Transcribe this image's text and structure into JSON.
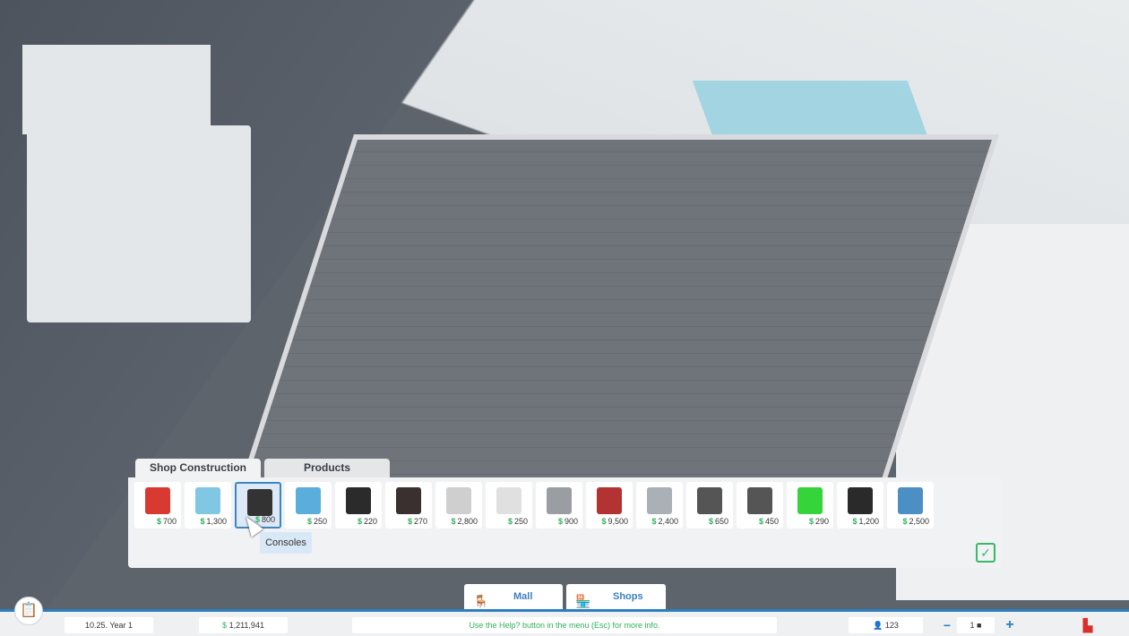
{
  "tabs": [
    {
      "label": "Shop Construction",
      "active": true
    },
    {
      "label": "Products",
      "active": false
    }
  ],
  "items": [
    {
      "icon": "gaming-chair",
      "price": "700",
      "color": "#d83a32"
    },
    {
      "icon": "glass-display-counter",
      "price": "1,300",
      "color": "#7fc7e3"
    },
    {
      "icon": "console-stand",
      "price": "800",
      "color": "#333333",
      "selected": true
    },
    {
      "icon": "glass-wall-shelf",
      "price": "250",
      "color": "#5aaedb"
    },
    {
      "icon": "display-pedestal",
      "price": "220",
      "color": "#2b2b2b"
    },
    {
      "icon": "product-shelf",
      "price": "270",
      "color": "#3a3030"
    },
    {
      "icon": "monitor-table",
      "price": "2,800",
      "color": "#cfcfcf"
    },
    {
      "icon": "vr-stand",
      "price": "250",
      "color": "#e0e0e0"
    },
    {
      "icon": "pc-desk-row",
      "price": "900",
      "color": "#9a9ea3"
    },
    {
      "icon": "showcase-pedestal",
      "price": "9,500",
      "color": "#b33232"
    },
    {
      "icon": "long-display-table",
      "price": "2,400",
      "color": "#aab0b6"
    },
    {
      "icon": "racing-simulator",
      "price": "650",
      "color": "#555555"
    },
    {
      "icon": "cube-display",
      "price": "450",
      "color": "#555555"
    },
    {
      "icon": "green-screen",
      "price": "290",
      "color": "#35d43a"
    },
    {
      "icon": "gaming-desk",
      "price": "1,200",
      "color": "#2a2a2a"
    },
    {
      "icon": "cashier-counter",
      "price": "2,500",
      "color": "#4c8fc4"
    }
  ],
  "extra_item": {
    "icon": "console-stand",
    "price": "800"
  },
  "tooltip": "Consoles",
  "confirm_icon": "check",
  "bottom_tabs": [
    {
      "label": "Mall",
      "icon": "bench"
    },
    {
      "label": "Shops",
      "icon": "storefront"
    }
  ],
  "status": {
    "date": "10.25.  Year 1",
    "money_symbol": "$",
    "money": "1,211,941",
    "message": "Use the Help? button in the menu (Esc) for more info.",
    "visitors": "123",
    "speed": "1"
  },
  "currency": "$",
  "colors": {
    "accent": "#2b7fc1",
    "money": "#2fb05a"
  }
}
